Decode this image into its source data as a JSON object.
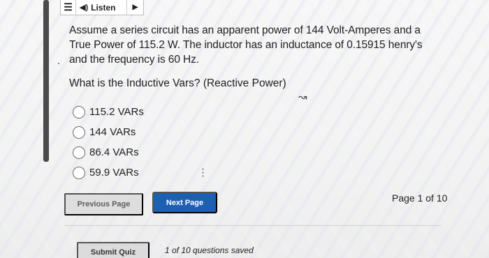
{
  "toolbar": {
    "menu_icon": "hamburger-menu-icon",
    "speaker_icon": "speaker-icon",
    "listen_label": "Listen",
    "play_icon": "play-icon"
  },
  "question": {
    "text": "Assume a series circuit has an apparent power of 144 Volt-Amperes and a True Power of 115.2 W. The inductor has an inductance of 0.15915 henry's and the frequency is 60 Hz.",
    "prompt": "What is the Inductive Vars? (Reactive Power)"
  },
  "options": [
    {
      "label": "115.2 VARs"
    },
    {
      "label": "144 VARs"
    },
    {
      "label": "86.4 VARs"
    },
    {
      "label": "59.9 VARs"
    }
  ],
  "navigation": {
    "previous_label": "Previous Page",
    "next_label": "Next Page",
    "page_info": "Page 1 of 10"
  },
  "footer": {
    "submit_label": "Submit Quiz",
    "saved_status": "1 of 10 questions saved"
  },
  "colors": {
    "next_button": "#1d5fb0",
    "left_bar": "#4a4a4a"
  }
}
